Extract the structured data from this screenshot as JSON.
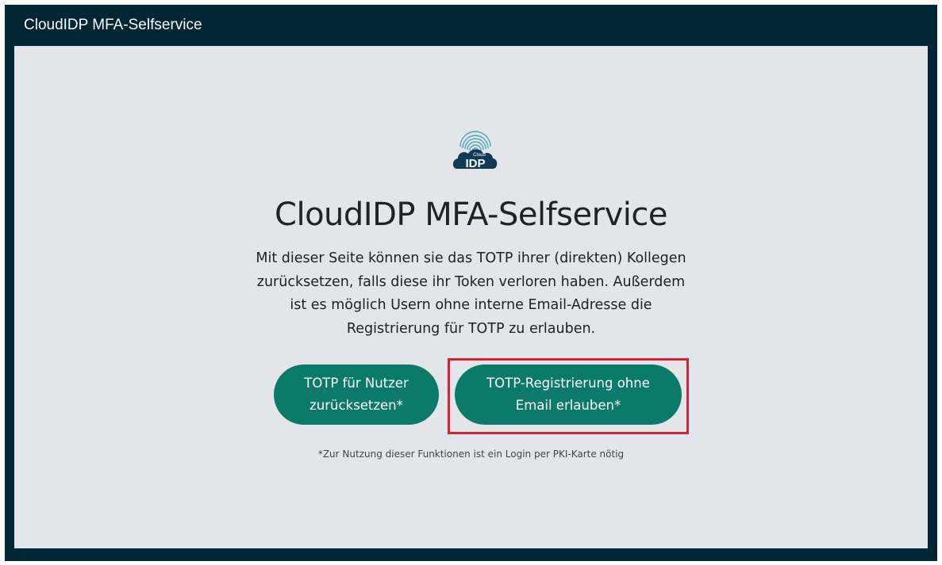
{
  "header": {
    "title": "CloudIDP MFA-Selfservice"
  },
  "logo": {
    "small_text": "Cloud",
    "big_text": "IDP"
  },
  "main": {
    "title": "CloudIDP MFA-Selfservice",
    "description": "Mit dieser Seite können sie das TOTP ihrer (direkten) Kollegen zurücksetzen, falls diese ihr Token verloren haben. Außerdem ist es möglich Usern ohne interne Email-Adresse die Registrierung für TOTP zu erlauben.",
    "buttons": {
      "reset_label": "TOTP für Nutzer zurücksetzen*",
      "register_label": "TOTP-Registrierung ohne Email erlauben*"
    },
    "footnote": "*Zur Nutzung dieser Funktionen ist ein Login per PKI-Karte nötig"
  },
  "colors": {
    "header_bg": "#012636",
    "content_bg": "#e2e5e9",
    "button_bg": "#0b7a68",
    "highlight": "#d9222e"
  }
}
